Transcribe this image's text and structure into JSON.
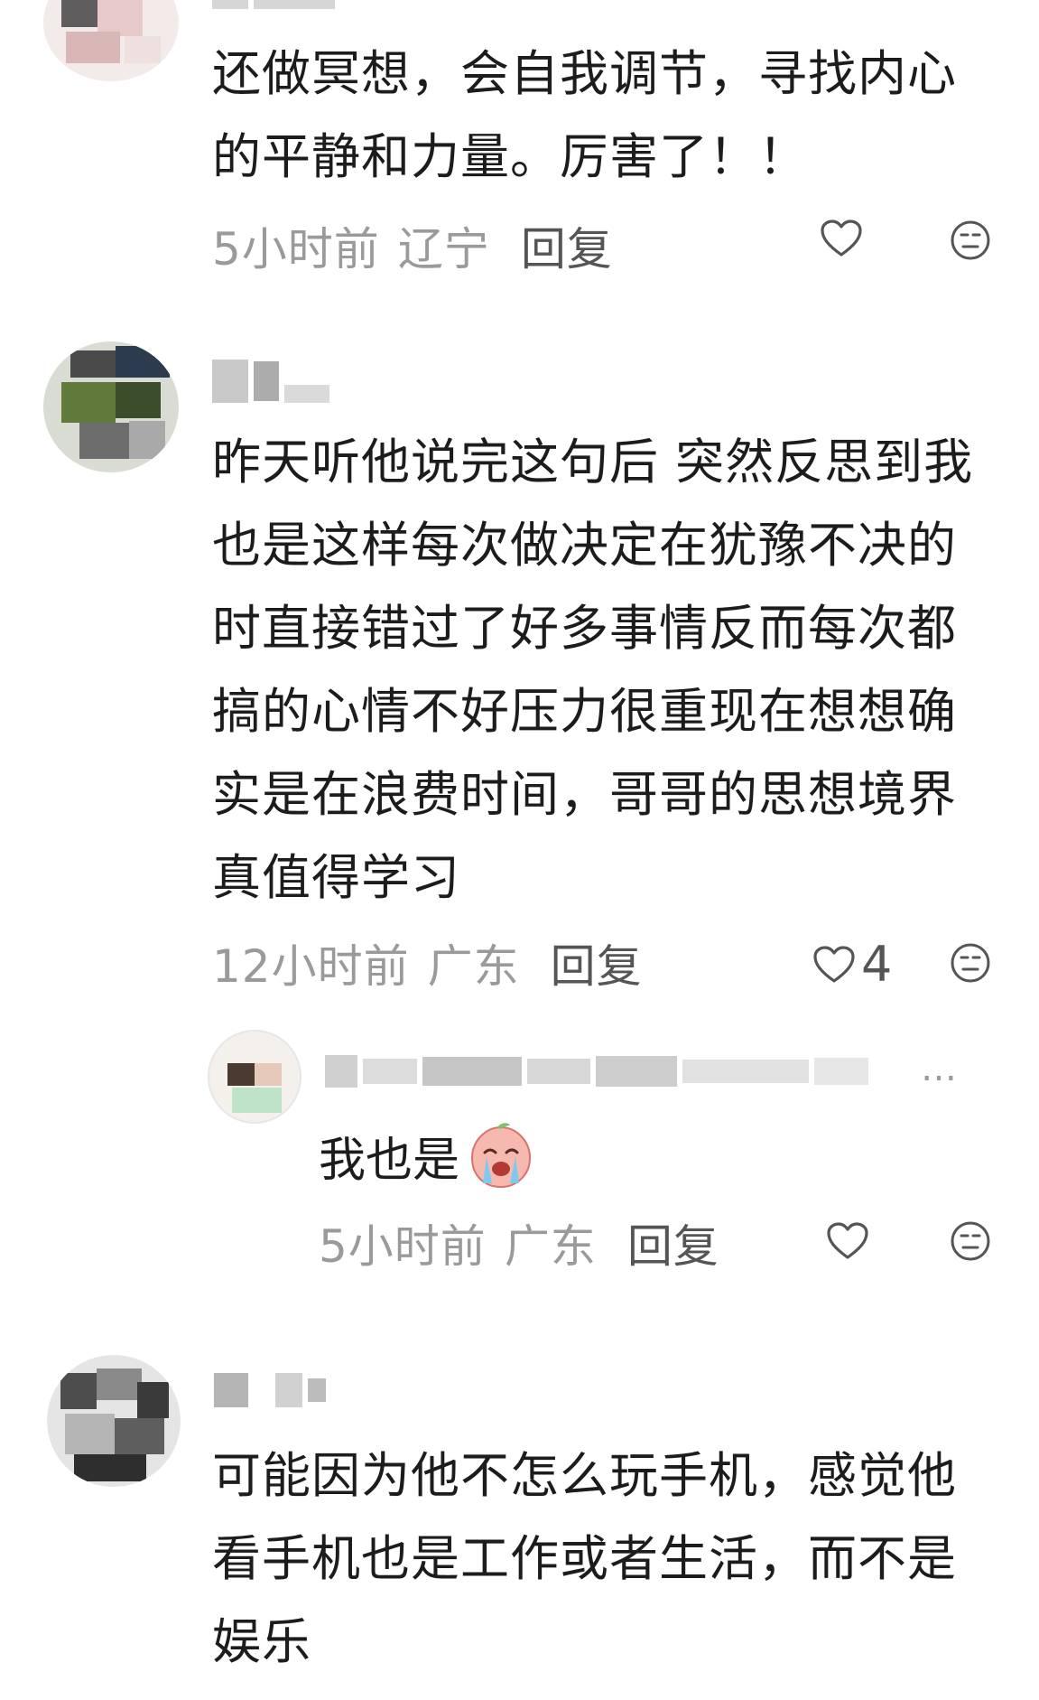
{
  "comments": [
    {
      "text": "还做冥想，会自我调节，寻找内心\n的平静和力量。厉害了！！",
      "time": "5小时前",
      "location": "辽宁",
      "reply_label": "回复",
      "likes": ""
    },
    {
      "text": "昨天听他说完这句后 突然反思到我\n也是这样每次做决定在犹豫不决的\n时直接错过了好多事情反而每次都\n搞的心情不好压力很重现在想想确\n实是在浪费时间，哥哥的思想境界\n真值得学习",
      "time": "12小时前",
      "location": "广东",
      "reply_label": "回复",
      "likes": "4",
      "reply": {
        "text": "我也是",
        "time": "5小时前",
        "location": "广东",
        "reply_label": "回复",
        "name_tail": "…"
      }
    },
    {
      "text": "可能因为他不怎么玩手机，感觉他\n看手机也是工作或者生活，而不是\n娱乐"
    }
  ],
  "icons": {
    "like": "heart-outline-icon",
    "react": "meh-face-icon",
    "emoji": "crying-peach-emoji"
  },
  "colors": {
    "text": "#1c1c1c",
    "meta": "#9a9a9a",
    "icon": "#555555"
  }
}
